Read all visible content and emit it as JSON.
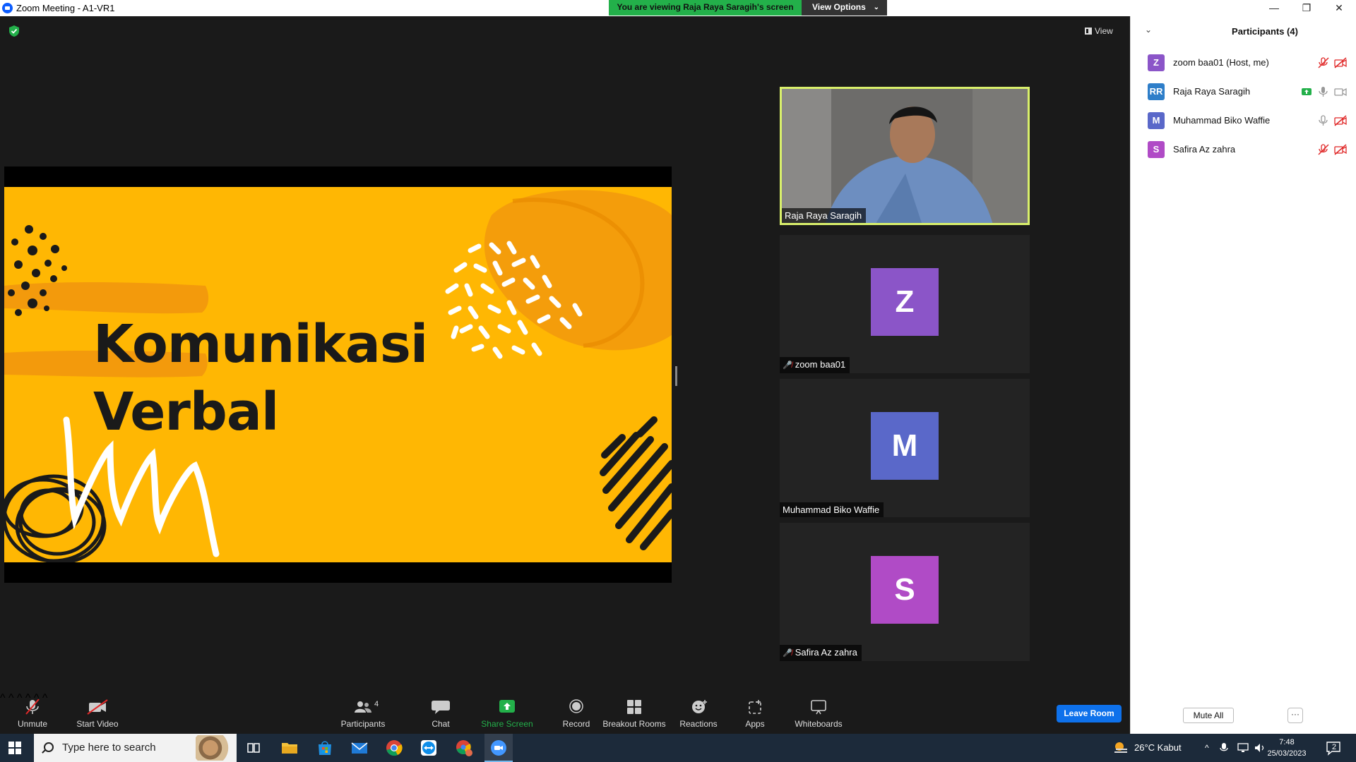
{
  "window": {
    "title": "Zoom Meeting - A1-VR1",
    "controls": [
      "—",
      "❐",
      "✕"
    ]
  },
  "share_banner": {
    "text": "You are viewing Raja Raya Saragih's screen",
    "view_options_label": "View Options"
  },
  "meeting": {
    "view_label": "View",
    "slide": {
      "title_line1": "Komunikasi",
      "title_line2": "Verbal",
      "colors": {
        "bg": "#ffb703",
        "accent": "#f39200",
        "ink": "#1a1a1a"
      }
    },
    "tiles": [
      {
        "name": "Raja Raya Saragih",
        "type": "video",
        "active_speaker": true
      },
      {
        "name": "zoom baa01",
        "initial": "Z",
        "color": "#8b55c8",
        "muted": true
      },
      {
        "name": "Muhammad Biko Waffie",
        "initial": "M",
        "color": "#5a68c9",
        "muted": false
      },
      {
        "name": "Safira Az zahra",
        "initial": "S",
        "color": "#b04bc6",
        "muted": true
      }
    ]
  },
  "toolbar": {
    "unmute": "Unmute",
    "start_video": "Start Video",
    "participants": "Participants",
    "participants_count": "4",
    "chat": "Chat",
    "share_screen": "Share Screen",
    "record": "Record",
    "breakout_rooms": "Breakout Rooms",
    "reactions": "Reactions",
    "apps": "Apps",
    "whiteboards": "Whiteboards",
    "leave": "Leave Room"
  },
  "participants_panel": {
    "title": "Participants (4)",
    "items": [
      {
        "initials": "Z",
        "name": "zoom baa01 (Host, me)",
        "color": "#8b55c8",
        "mic": "muted",
        "video": "off",
        "sharing": false
      },
      {
        "initials": "RR",
        "name": "Raja Raya Saragih",
        "color": "#2e7ec9",
        "mic": "on",
        "video": "on",
        "sharing": true
      },
      {
        "initials": "M",
        "name": "Muhammad Biko Waffie",
        "color": "#5a68c9",
        "mic": "on",
        "video": "off",
        "sharing": false
      },
      {
        "initials": "S",
        "name": "Safira Az zahra",
        "color": "#b04bc6",
        "mic": "muted",
        "video": "off",
        "sharing": false
      }
    ],
    "mute_all": "Mute All",
    "more": "···"
  },
  "taskbar": {
    "search_placeholder": "Type here to search",
    "weather": "26°C  Kabut",
    "time": "7:48",
    "date": "25/03/2023",
    "notifications": "2",
    "apps": [
      "task-view",
      "file-explorer",
      "microsoft-store",
      "mail",
      "chrome",
      "teamviewer",
      "chrome-profile",
      "zoom"
    ]
  }
}
